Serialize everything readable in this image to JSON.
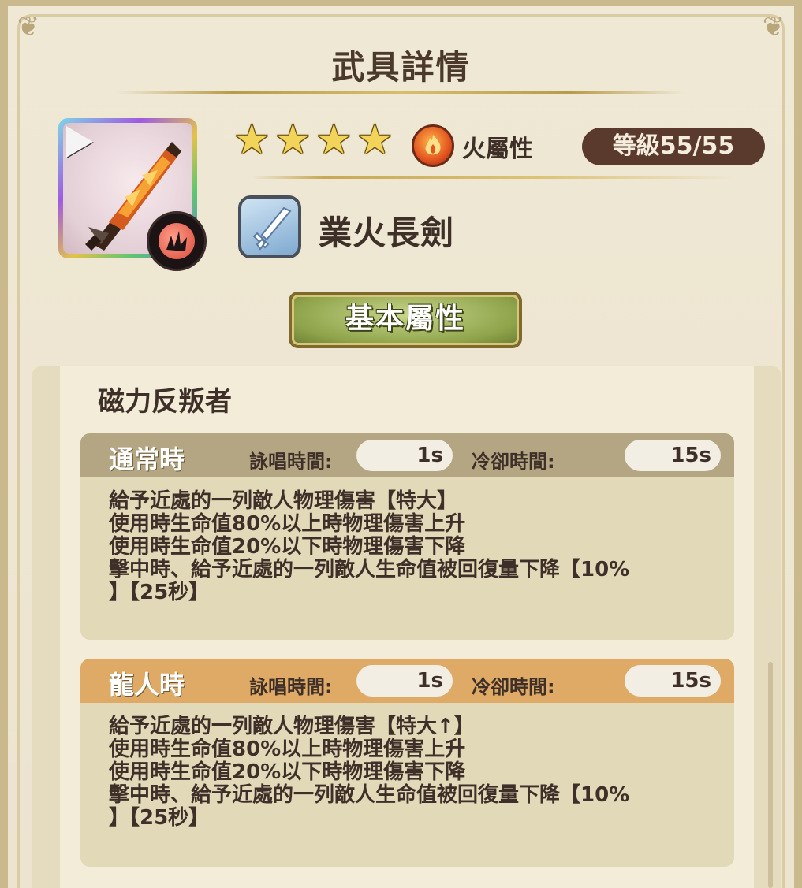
{
  "header": {
    "title": "武具詳情"
  },
  "weapon": {
    "stars": 4,
    "attribute_label": "火屬性",
    "level_label": "等級55/55",
    "name": "業火長劍",
    "icons": [
      "play-icon",
      "weapon-art-icon",
      "slash-element-icon",
      "fire-element-icon",
      "sword-type-icon"
    ]
  },
  "tab_button": {
    "label": "基本屬性"
  },
  "skill": {
    "name": "磁力反叛者",
    "normal": {
      "title": "通常時",
      "cast_label": "詠唱時間:",
      "cast_value": "1s",
      "cool_label": "冷卻時間:",
      "cool_value": "15s",
      "lines": [
        "給予近處的一列敵人物理傷害【特大】",
        "使用時生命值80%以上時物理傷害上升",
        "使用時生命值20%以下時物理傷害下降",
        "擊中時、給予近處的一列敵人生命值被回復量下降【10%",
        "】【25秒】"
      ]
    },
    "dragon": {
      "title": "龍人時",
      "cast_label": "詠唱時間:",
      "cast_value": "1s",
      "cool_label": "冷卻時間:",
      "cool_value": "15s",
      "lines": [
        "給予近處的一列敵人物理傷害【特大↑】",
        "使用時生命值80%以上時物理傷害上升",
        "使用時生命值20%以下時物理傷害下降",
        "擊中時、給予近處的一列敵人生命值被回復量下降【10%",
        "】【25秒】"
      ]
    }
  },
  "colors": {
    "normal_header": "#b4a683",
    "dragon_header": "#dfa966",
    "level_pill": "#5a3a2c",
    "button_green": "#8ea34a"
  }
}
